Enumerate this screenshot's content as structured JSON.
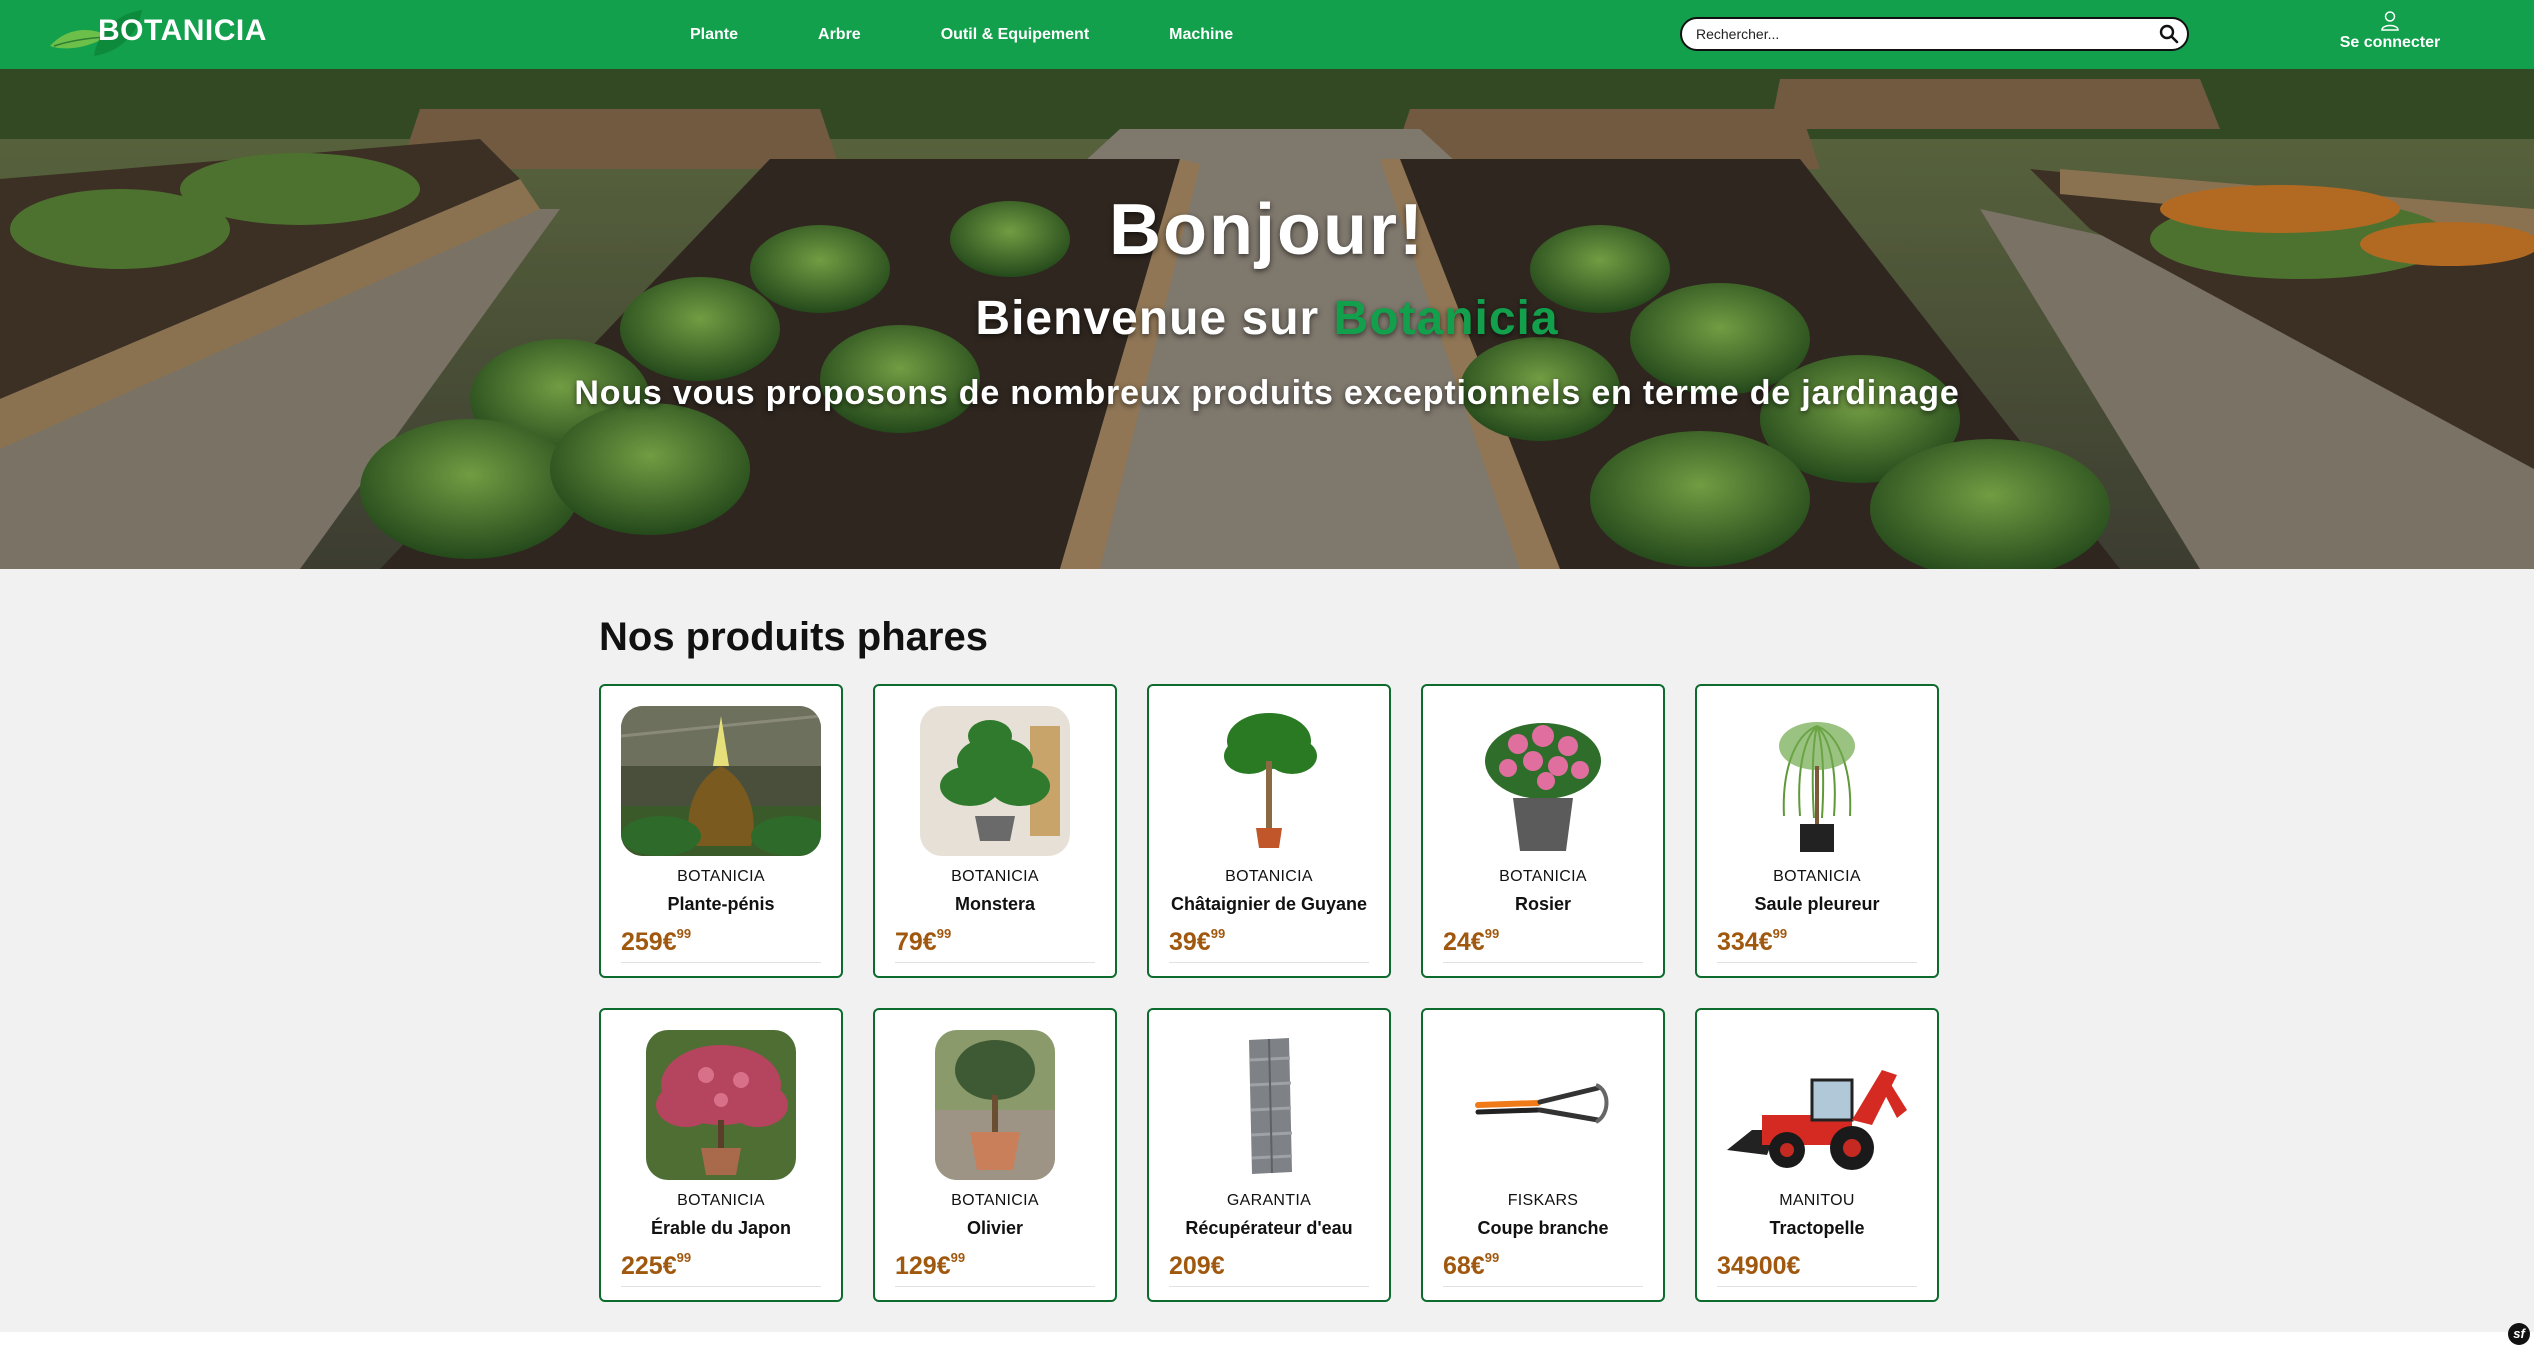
{
  "brand": {
    "name": "BOTANICIA",
    "logo_icon": "leaf-icon",
    "color": "#12a04c"
  },
  "nav": {
    "links": [
      "Plante",
      "Arbre",
      "Outil & Equipement",
      "Machine"
    ]
  },
  "search": {
    "placeholder": "Rechercher...",
    "icon": "search-icon"
  },
  "login": {
    "label": "Se connecter",
    "icon": "user-icon"
  },
  "hero": {
    "title": "Bonjour!",
    "subtitle_prefix": "Bienvenue sur ",
    "subtitle_brand": "Botanicia",
    "description": "Nous vous proposons de nombreux produits exceptionnels en terme de jardinage"
  },
  "products": {
    "title": "Nos produits phares",
    "items": [
      {
        "brand": "BOTANICIA",
        "name": "Plante-pénis",
        "price_main": "259€",
        "price_cents": "99"
      },
      {
        "brand": "BOTANICIA",
        "name": "Monstera",
        "price_main": "79€",
        "price_cents": "99"
      },
      {
        "brand": "BOTANICIA",
        "name": "Châtaignier de Guyane",
        "price_main": "39€",
        "price_cents": "99"
      },
      {
        "brand": "BOTANICIA",
        "name": "Rosier",
        "price_main": "24€",
        "price_cents": "99"
      },
      {
        "brand": "BOTANICIA",
        "name": "Saule pleureur",
        "price_main": "334€",
        "price_cents": "99"
      },
      {
        "brand": "BOTANICIA",
        "name": "Érable du Japon",
        "price_main": "225€",
        "price_cents": "99"
      },
      {
        "brand": "BOTANICIA",
        "name": "Olivier",
        "price_main": "129€",
        "price_cents": "99"
      },
      {
        "brand": "GARANTIA",
        "name": "Récupérateur d'eau",
        "price_main": "209€",
        "price_cents": ""
      },
      {
        "brand": "FISKARS",
        "name": "Coupe branche",
        "price_main": "68€",
        "price_cents": "99"
      },
      {
        "brand": "MANITOU",
        "name": "Tractopelle",
        "price_main": "34900€",
        "price_cents": ""
      }
    ]
  },
  "colors": {
    "price": "#a0580e",
    "card_border": "#0e6b2e",
    "page_bg": "#f1f1f1"
  }
}
